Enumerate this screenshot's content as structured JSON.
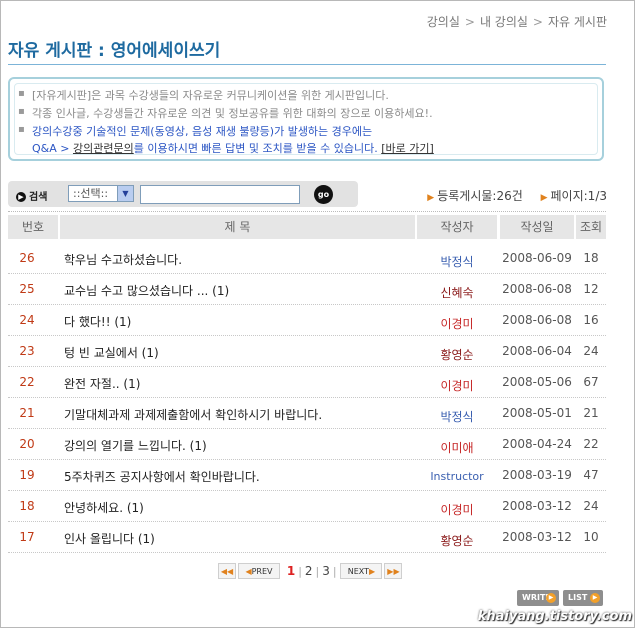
{
  "breadcrumb": [
    "강의실",
    "내 강의실",
    "자유 게시판"
  ],
  "breadcrumb_separator": ">",
  "page_title": "자유 게시판 : 영어에세이쓰기",
  "notice": {
    "line1": "[자유게시판]은 과목 수강생들의 자유로운 커뮤니케이션을 위한 게시판입니다.",
    "line2": "각종 인사글, 수강생들간 자유로운 의견 및 정보공유를 위한 대화의 장으로 이용하세요!.",
    "line3": "강의수강중 기술적인 문제(동영상, 음성 재생 불량등)가 발생하는 경우에는",
    "line4_a": "Q&A >",
    "line4_b": "강의관련문의",
    "line4_c": "를 이용하시면 빠른 답변 및 조치를 받을 수 있습니다.",
    "line4_link": "[바로 가기]"
  },
  "search": {
    "label": "검색",
    "select_value": "::선택::",
    "input_value": "",
    "go_label": "go"
  },
  "stats": {
    "post_count": "등록게시물:26건",
    "page_info": "페이지:1/3"
  },
  "table": {
    "headers": {
      "num": "번호",
      "title": "제 목",
      "author": "작성자",
      "date": "작성일",
      "views": "조회"
    },
    "rows": [
      {
        "num": "26",
        "title": "학우님 수고하셨습니다.",
        "author": "박정식",
        "author_color": "#3a5fb0",
        "date": "2008-06-09",
        "views": "18"
      },
      {
        "num": "25",
        "title": "교수님 수고 많으셨습니다 ... (1)",
        "author": "신혜숙",
        "author_color": "#8b1a1a",
        "date": "2008-06-08",
        "views": "12"
      },
      {
        "num": "24",
        "title": "다 했다!! (1)",
        "author": "이경미",
        "author_color": "#c62828",
        "date": "2008-06-08",
        "views": "16"
      },
      {
        "num": "23",
        "title": "텅 빈 교실에서 (1)",
        "author": "황영순",
        "author_color": "#8b1a1a",
        "date": "2008-06-04",
        "views": "24"
      },
      {
        "num": "22",
        "title": "완전 자절.. (1)",
        "author": "이경미",
        "author_color": "#c62828",
        "date": "2008-05-06",
        "views": "67"
      },
      {
        "num": "21",
        "title": "기말대체과제 과제제출함에서 확인하시기 바랍니다.",
        "author": "박정식",
        "author_color": "#3a5fb0",
        "date": "2008-05-01",
        "views": "21"
      },
      {
        "num": "20",
        "title": "강의의 열기를 느낍니다. (1)",
        "author": "이미애",
        "author_color": "#c62828",
        "date": "2008-04-24",
        "views": "22"
      },
      {
        "num": "19",
        "title": "5주차퀴즈 공지사항에서 확인바랍니다.",
        "author": "Instructor",
        "author_color": "#3a5fb0",
        "date": "2008-03-19",
        "views": "47"
      },
      {
        "num": "18",
        "title": "안녕하세요. (1)",
        "author": "이경미",
        "author_color": "#c62828",
        "date": "2008-03-12",
        "views": "24"
      },
      {
        "num": "17",
        "title": "인사 올립니다 (1)",
        "author": "황영순",
        "author_color": "#8b1a1a",
        "date": "2008-03-12",
        "views": "10"
      }
    ]
  },
  "pagination": {
    "prev_label": "PREV",
    "next_label": "NEXT",
    "pages": [
      "1",
      "2",
      "3"
    ],
    "current_page": "1"
  },
  "buttons": {
    "write_label": "WRITE",
    "list_label": "LIST"
  },
  "watermark": "khaiyang.tistory.com"
}
